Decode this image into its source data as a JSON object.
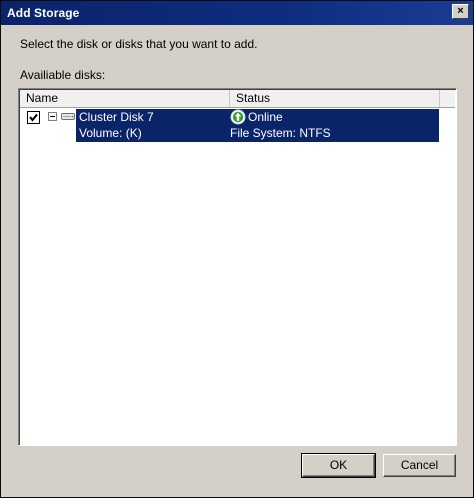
{
  "window": {
    "title": "Add Storage",
    "close_glyph": "×"
  },
  "instructions": "Select the disk or disks that you want to add.",
  "list": {
    "label": "Availiable disks:",
    "columns": [
      "Name",
      "Status"
    ],
    "rows": [
      {
        "checked": true,
        "expanded": true,
        "name": "Cluster Disk 7",
        "status": "Online",
        "status_icon": "online-arrow-icon",
        "sub_name": "Volume: (K)",
        "sub_status": "File System: NTFS"
      }
    ]
  },
  "buttons": {
    "ok": "OK",
    "cancel": "Cancel"
  },
  "colors": {
    "title_bar": "#0a246a",
    "selection": "#0a246a",
    "status_online": "#2e9e3a"
  }
}
